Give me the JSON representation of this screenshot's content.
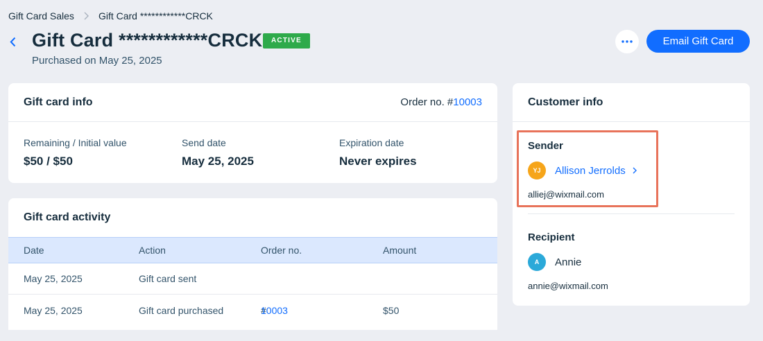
{
  "breadcrumb": {
    "parent": "Gift Card Sales",
    "current": "Gift Card ************CRCK"
  },
  "header": {
    "title": "Gift Card ************CRCK",
    "status": "ACTIVE",
    "subtitle": "Purchased on May 25, 2025",
    "primary_action": "Email Gift Card",
    "more_icon": "ellipsis-icon"
  },
  "colors": {
    "accent": "#116dff",
    "status": "#2eaa4a",
    "highlight": "#e8735a"
  },
  "gift_card_info": {
    "title": "Gift card info",
    "order_label": "Order no. #",
    "order_number": "10003",
    "stats": [
      {
        "label": "Remaining / Initial value",
        "value": "$50 / $50"
      },
      {
        "label": "Send date",
        "value": "May 25, 2025"
      },
      {
        "label": "Expiration date",
        "value": "Never expires"
      }
    ]
  },
  "activity": {
    "title": "Gift card activity",
    "columns": [
      "Date",
      "Action",
      "Order no.",
      "Amount"
    ],
    "rows": [
      {
        "date": "May 25, 2025",
        "action": "Gift card sent",
        "order_prefix": "",
        "order": "",
        "amount": ""
      },
      {
        "date": "May 25, 2025",
        "action": "Gift card purchased",
        "order_prefix": "#",
        "order": "10003",
        "amount": "$50"
      }
    ]
  },
  "customer": {
    "title": "Customer info",
    "sender": {
      "role": "Sender",
      "initials": "YJ",
      "name": "Allison Jerrolds",
      "email": "alliej@wixmail.com",
      "avatar_color": "#f6a51a"
    },
    "recipient": {
      "role": "Recipient",
      "initials": "A",
      "name": "Annie",
      "email": "annie@wixmail.com",
      "avatar_color": "#2ba9d9"
    }
  }
}
